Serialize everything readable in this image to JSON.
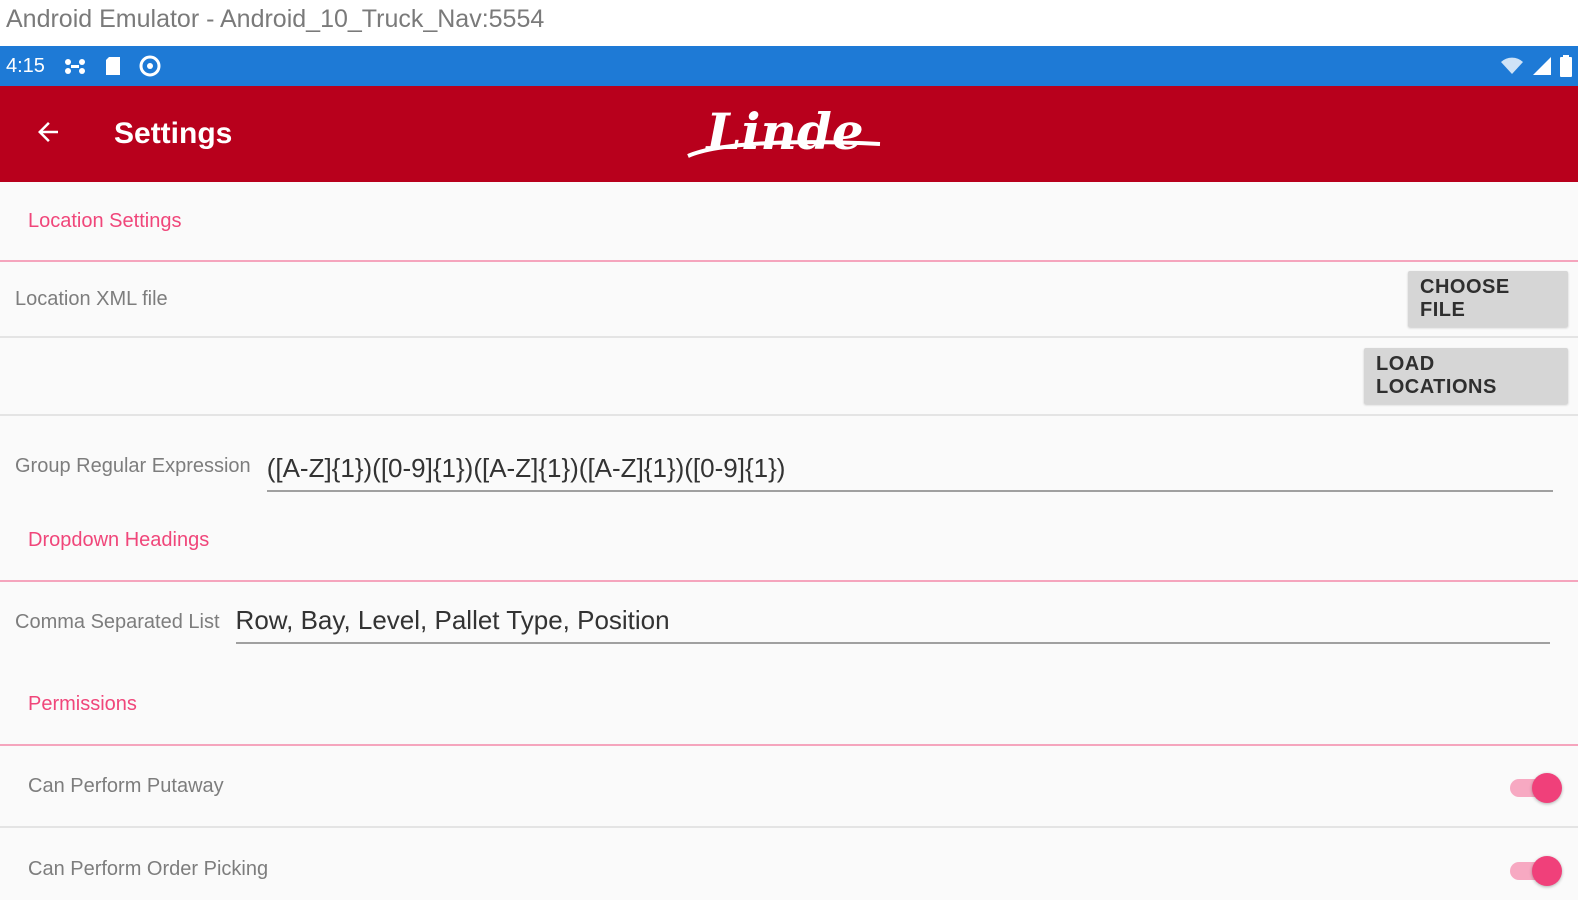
{
  "window": {
    "title": "Android Emulator - Android_10_Truck_Nav:5554"
  },
  "status_bar": {
    "time": "4:15",
    "background": "#1e7ad6"
  },
  "toolbar": {
    "title": "Settings",
    "logo_text": "Linde",
    "background": "#b8001c",
    "back_icon": "arrow-back-icon"
  },
  "sections": {
    "location": {
      "header": "Location Settings",
      "xml_label": "Location XML file",
      "choose_file_label": "CHOOSE FILE",
      "load_locations_label": "LOAD LOCATIONS",
      "regex_label": "Group Regular Expression",
      "regex_value": "([A-Z]{1})([0-9]{1})([A-Z]{1})([A-Z]{1})([0-9]{1})"
    },
    "dropdown": {
      "header": "Dropdown Headings",
      "list_label": "Comma Separated List",
      "list_value": "Row, Bay, Level, Pallet Type, Position"
    },
    "permissions": {
      "header": "Permissions",
      "items": [
        {
          "label": "Can Perform Putaway",
          "enabled": true
        },
        {
          "label": "Can Perform Order Picking",
          "enabled": true
        }
      ]
    }
  },
  "colors": {
    "accent": "#f0407a",
    "section_header": "#f0467a"
  }
}
